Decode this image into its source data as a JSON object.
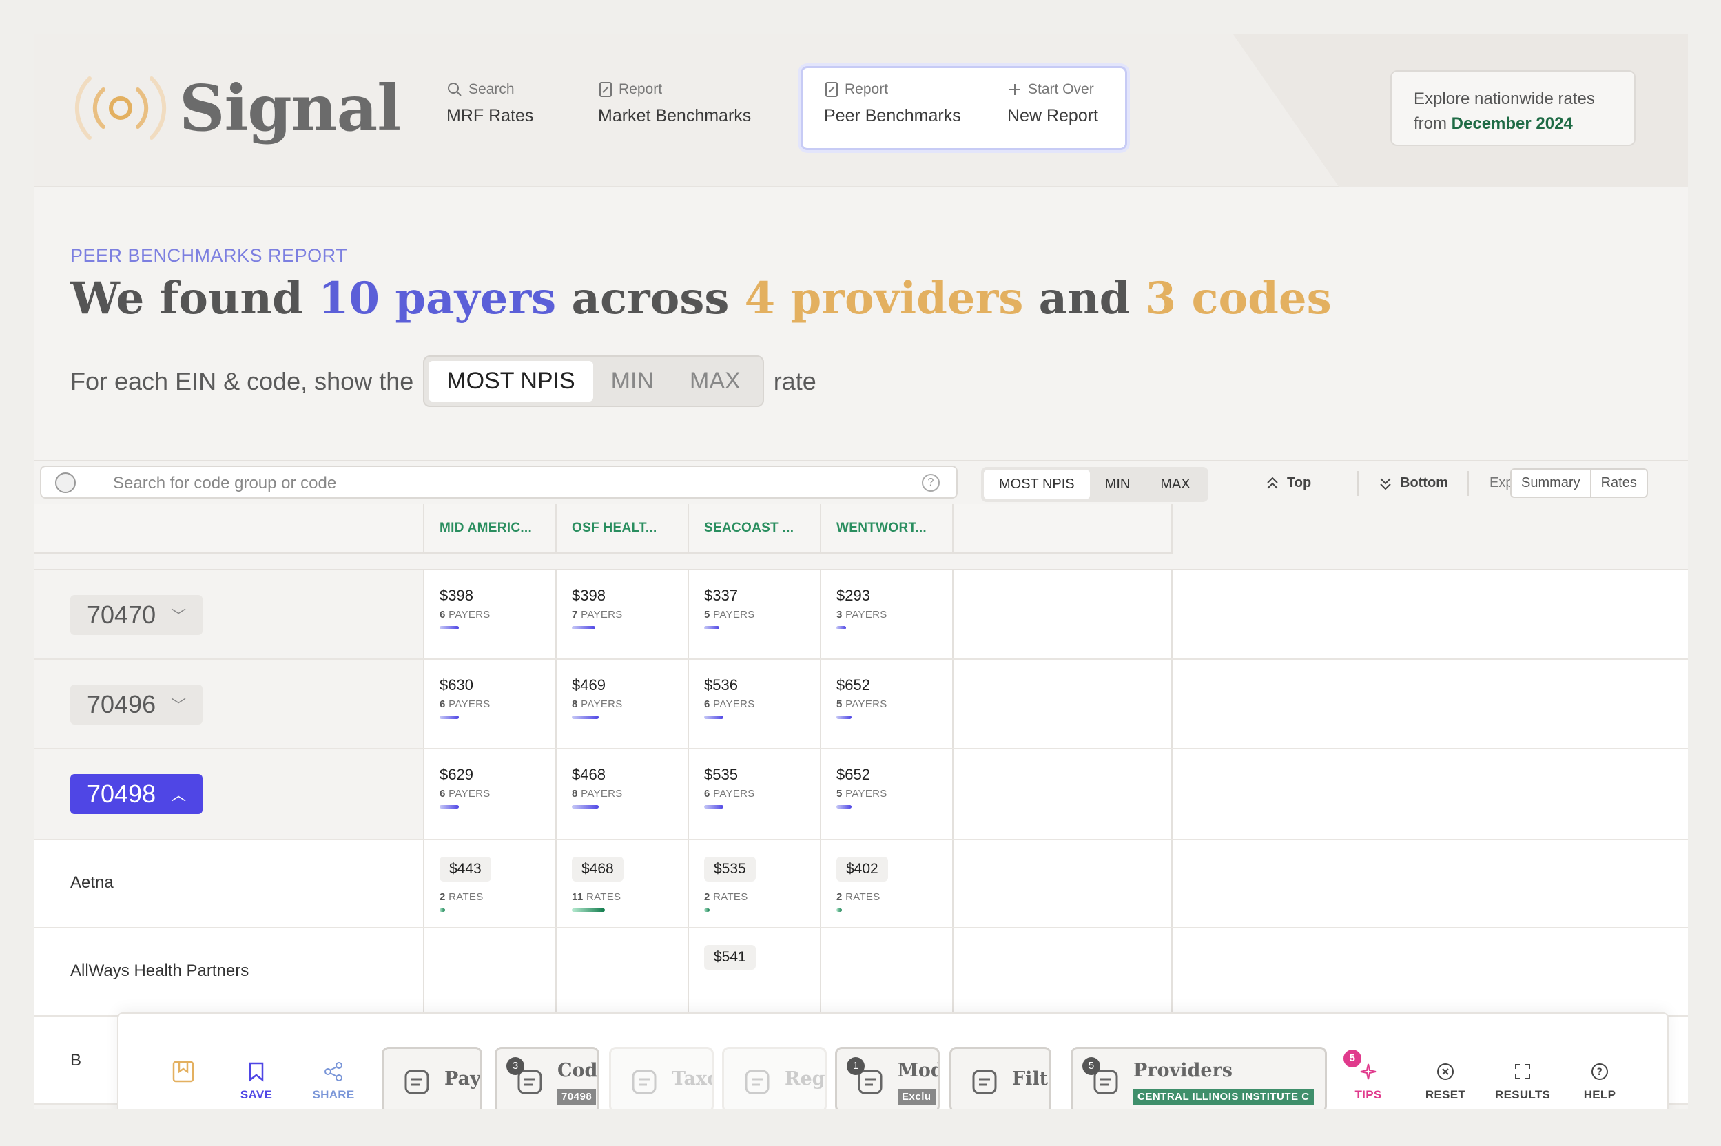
{
  "brand": {
    "name": "Signal"
  },
  "nav": [
    {
      "small": "Search",
      "big": "MRF Rates",
      "icon": "search-icon"
    },
    {
      "small": "Report",
      "big": "Market Benchmarks",
      "icon": "report-icon"
    },
    {
      "small": "Report",
      "big": "Peer Benchmarks",
      "icon": "report-icon"
    },
    {
      "small": "Start Over",
      "big": "New Report",
      "icon": "plus-icon"
    }
  ],
  "explore": {
    "line1": "Explore nationwide rates",
    "line2_prefix": "from ",
    "line2_date": "December 2024"
  },
  "report": {
    "kicker": "PEER BENCHMARKS REPORT",
    "h_we_found": "We found",
    "h_payers": "10 payers",
    "h_across": "across",
    "h_providers": "4 providers",
    "h_and": "and",
    "h_codes": "3 codes",
    "pick_prefix": "For each EIN & code, show the",
    "pick_suffix": "rate",
    "options": [
      "MOST NPIS",
      "MIN",
      "MAX"
    ],
    "selected": "MOST NPIS"
  },
  "toolbar": {
    "search_placeholder": "Search for code group or code",
    "help": "?",
    "options": [
      "MOST NPIS",
      "MIN",
      "MAX"
    ],
    "top": "Top",
    "bottom": "Bottom",
    "export": "Export",
    "summary": "Summary",
    "rates": "Rates"
  },
  "columns": [
    "MID AMERIC...",
    "OSF HEALT...",
    "SEACOAST ...",
    "WENTWORT..."
  ],
  "code_rows": [
    {
      "code": "70470",
      "expanded": false,
      "cells": [
        {
          "price": "$398",
          "count": "6",
          "unit": "PAYERS",
          "fill": 0.5
        },
        {
          "price": "$398",
          "count": "7",
          "unit": "PAYERS",
          "fill": 0.6
        },
        {
          "price": "$337",
          "count": "5",
          "unit": "PAYERS",
          "fill": 0.4
        },
        {
          "price": "$293",
          "count": "3",
          "unit": "PAYERS",
          "fill": 0.25
        }
      ]
    },
    {
      "code": "70496",
      "expanded": false,
      "cells": [
        {
          "price": "$630",
          "count": "6",
          "unit": "PAYERS",
          "fill": 0.5
        },
        {
          "price": "$469",
          "count": "8",
          "unit": "PAYERS",
          "fill": 0.7
        },
        {
          "price": "$536",
          "count": "6",
          "unit": "PAYERS",
          "fill": 0.5
        },
        {
          "price": "$652",
          "count": "5",
          "unit": "PAYERS",
          "fill": 0.4
        }
      ]
    },
    {
      "code": "70498",
      "expanded": true,
      "cells": [
        {
          "price": "$629",
          "count": "6",
          "unit": "PAYERS",
          "fill": 0.5
        },
        {
          "price": "$468",
          "count": "8",
          "unit": "PAYERS",
          "fill": 0.7
        },
        {
          "price": "$535",
          "count": "6",
          "unit": "PAYERS",
          "fill": 0.5
        },
        {
          "price": "$652",
          "count": "5",
          "unit": "PAYERS",
          "fill": 0.4
        }
      ]
    }
  ],
  "payer_rows": [
    {
      "name": "Aetna",
      "cells": [
        {
          "price": "$443",
          "count": "2",
          "unit": "RATES",
          "fill": 0.15
        },
        {
          "price": "$468",
          "count": "11",
          "unit": "RATES",
          "fill": 0.85
        },
        {
          "price": "$535",
          "count": "2",
          "unit": "RATES",
          "fill": 0.15
        },
        {
          "price": "$402",
          "count": "2",
          "unit": "RATES",
          "fill": 0.15
        }
      ]
    },
    {
      "name": "AllWays Health Partners",
      "cells": [
        null,
        null,
        {
          "price": "$541"
        },
        null
      ]
    },
    {
      "name": "B",
      "cells": [
        null,
        null,
        null,
        null
      ]
    }
  ],
  "bottom_bar": {
    "save": "SAVE",
    "share": "SHARE",
    "chips": [
      {
        "label": "Paye",
        "badge": "",
        "sub": "",
        "faint": false
      },
      {
        "label": "Code",
        "badge": "3",
        "sub": "70498",
        "faint": false
      },
      {
        "label": "Taxo",
        "badge": "",
        "sub": "",
        "faint": true
      },
      {
        "label": "Regi",
        "badge": "",
        "sub": "",
        "faint": true
      },
      {
        "label": "Modi",
        "badge": "1",
        "sub": "Exclu",
        "faint": false
      },
      {
        "label": "Filte",
        "badge": "",
        "sub": "",
        "faint": false
      },
      {
        "label": "Providers",
        "badge": "5",
        "sub": "CENTRAL ILLINOIS INSTITUTE C",
        "faint": false
      }
    ],
    "tips": "TIPS",
    "tips_badge": "5",
    "reset": "RESET",
    "results": "RESULTS",
    "help": "HELP"
  },
  "colors": {
    "accent": "#4f46e5",
    "gold": "#e3b060",
    "green": "#2a8e5f",
    "pink": "#e03a8c"
  }
}
